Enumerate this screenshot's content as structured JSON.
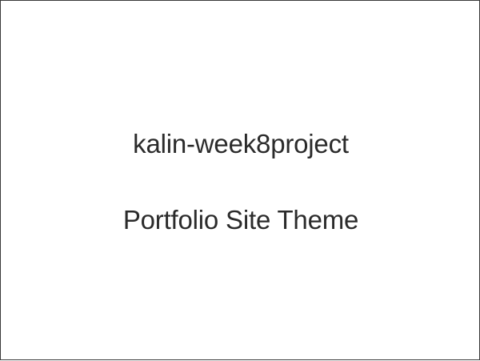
{
  "slide": {
    "title": "kalin-week8project",
    "subtitle": "Portfolio Site Theme"
  },
  "colors": {
    "background": "#ffffff",
    "text": "#2b2b2b",
    "border": "#3a3a3a"
  }
}
